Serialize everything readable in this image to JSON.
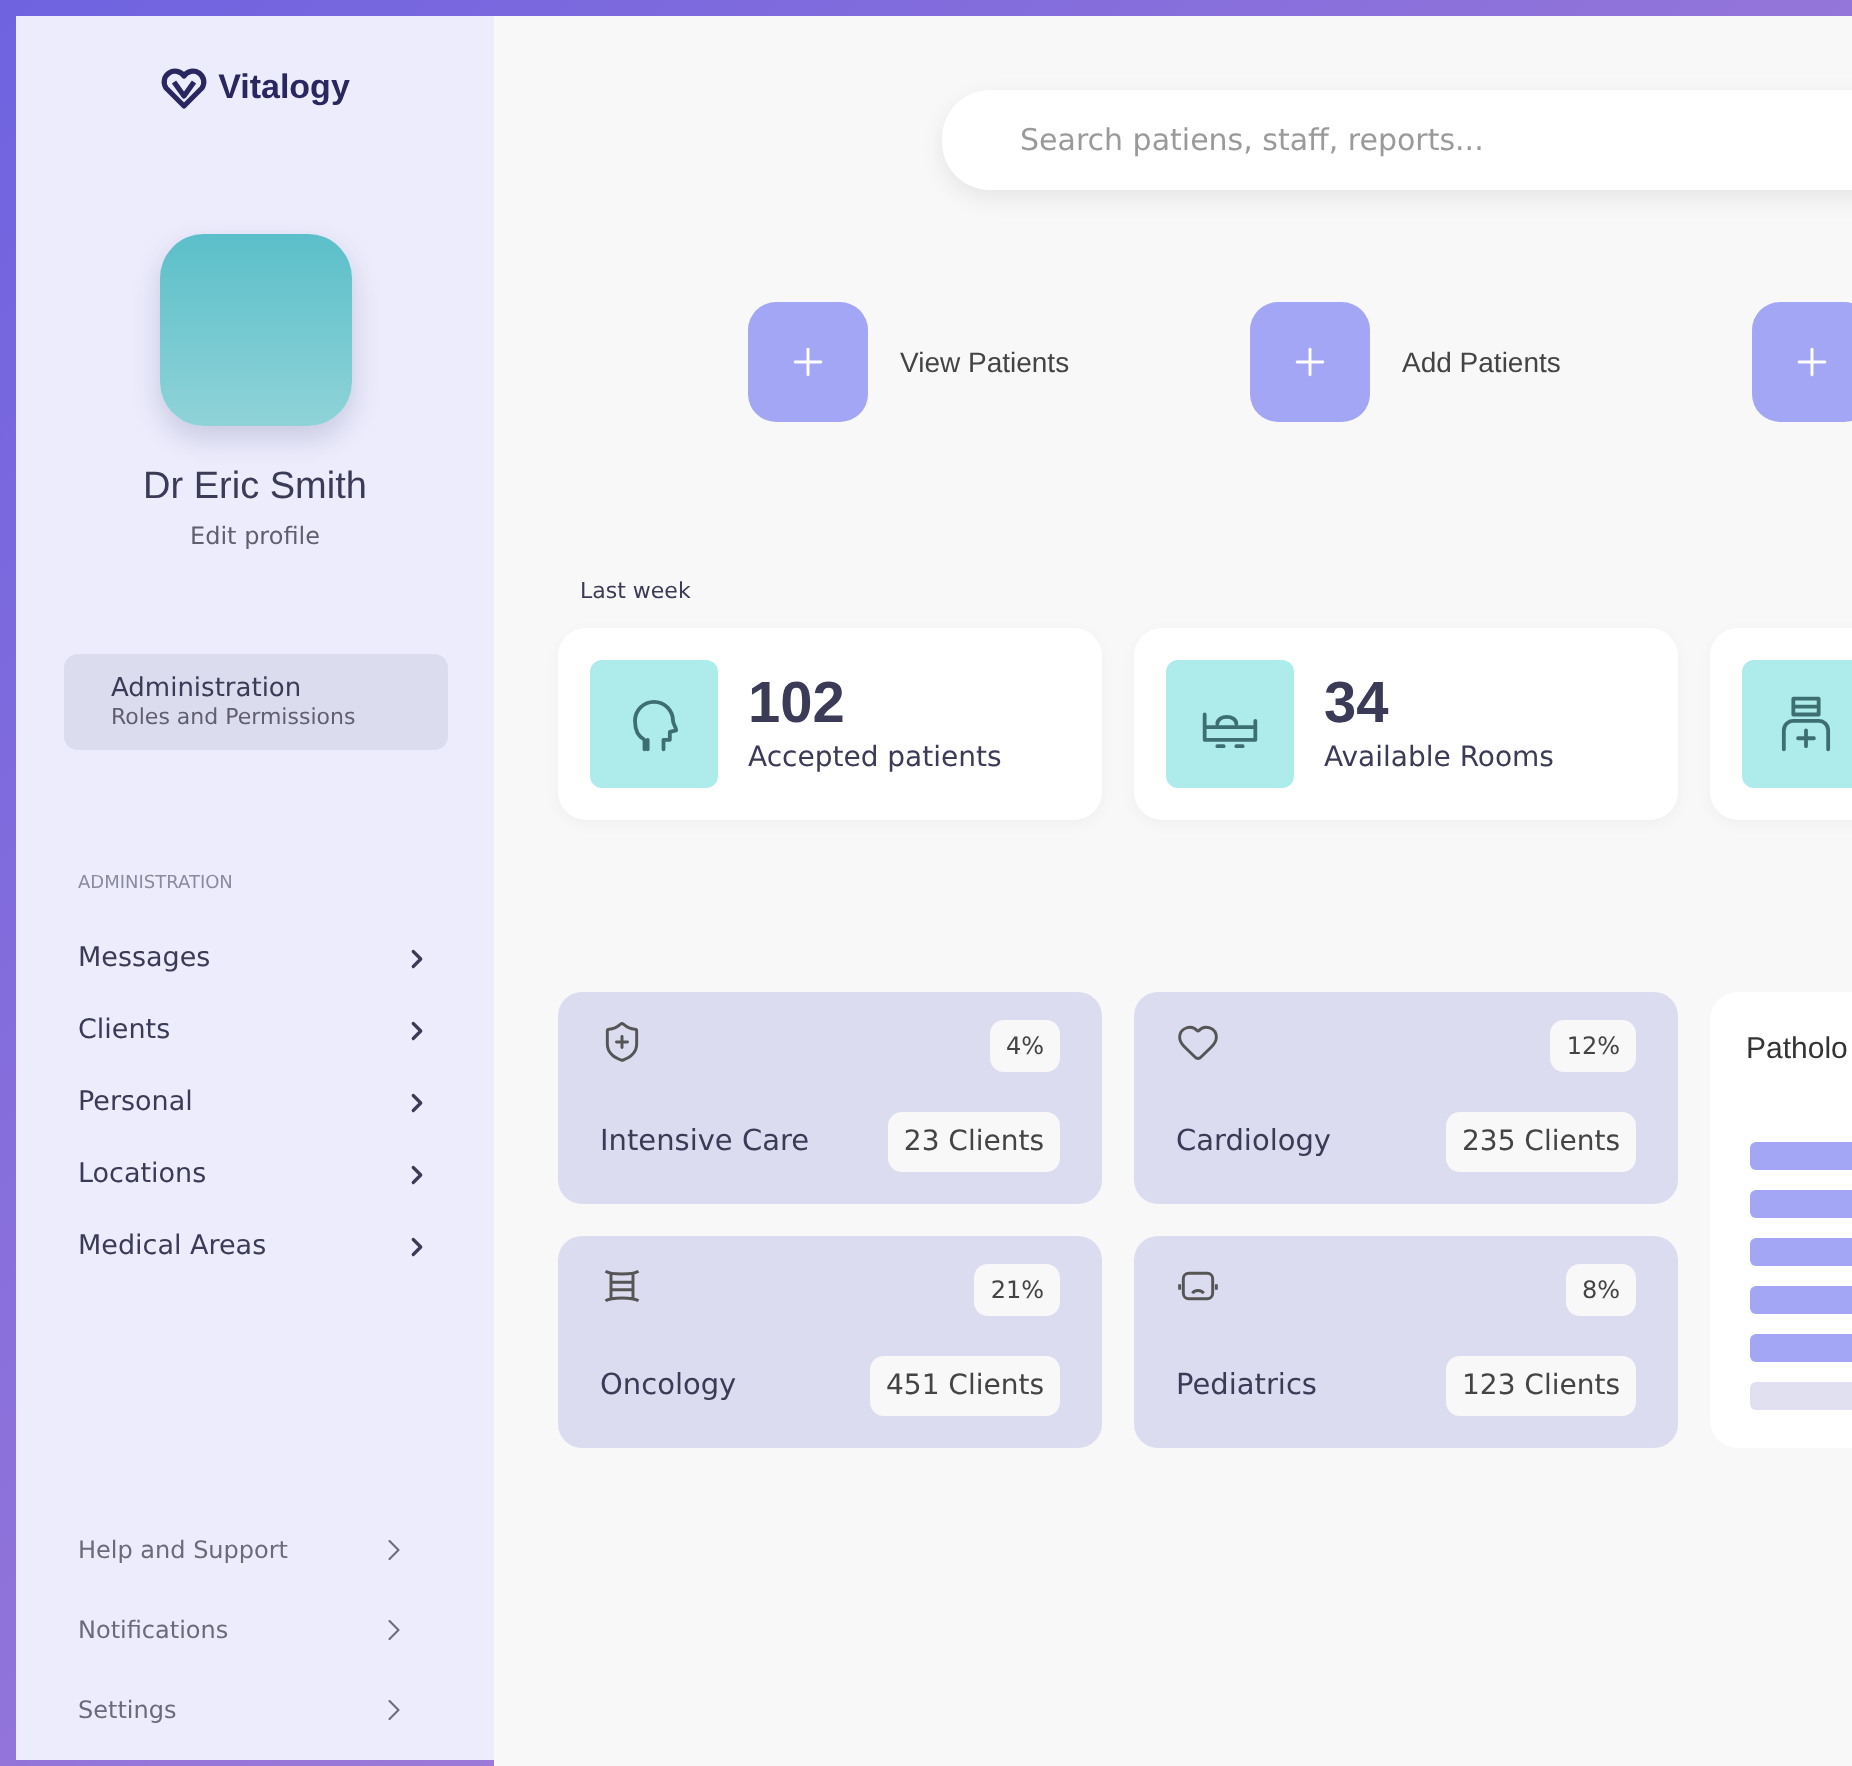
{
  "brand": {
    "name": "Vitalogy"
  },
  "profile": {
    "name": "Dr Eric Smith",
    "link": "Edit profile"
  },
  "role_card": {
    "title": "Administration",
    "subtitle": "Roles and Permissions"
  },
  "menu": {
    "heading": "ADMINISTRATION",
    "items": [
      {
        "label": "Messages"
      },
      {
        "label": "Clients"
      },
      {
        "label": "Personal"
      },
      {
        "label": "Locations"
      },
      {
        "label": "Medical Areas"
      }
    ]
  },
  "footer_menu": [
    {
      "label": "Help and Support"
    },
    {
      "label": "Notifications"
    },
    {
      "label": "Settings"
    }
  ],
  "search": {
    "placeholder": "Search patiens, staff, reports..."
  },
  "actions": [
    {
      "label": "View Patients"
    },
    {
      "label": "Add Patients"
    }
  ],
  "stats": {
    "heading": "Last week",
    "items": [
      {
        "kind": "head",
        "value": "102",
        "label": "Accepted patients"
      },
      {
        "kind": "bed",
        "value": "34",
        "label": "Available Rooms"
      }
    ]
  },
  "departments": [
    {
      "kind": "shield",
      "name": "Intensive Care",
      "share": "4%",
      "clients": "23 Clients"
    },
    {
      "kind": "heart",
      "name": "Cardiology",
      "share": "12%",
      "clients": "235 Clients"
    },
    {
      "kind": "mask",
      "name": "Oncology",
      "share": "21%",
      "clients": "451 Clients"
    },
    {
      "kind": "face",
      "name": "Pediatrics",
      "share": "8%",
      "clients": "123 Clients"
    }
  ],
  "pathology": {
    "title": "Patholo"
  }
}
